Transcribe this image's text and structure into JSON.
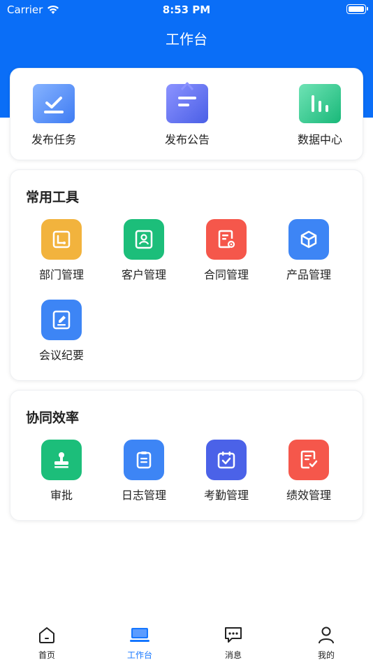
{
  "status": {
    "carrier": "Carrier",
    "time": "8:53 PM"
  },
  "header": {
    "title": "工作台"
  },
  "top_actions": [
    {
      "label": "发布任务",
      "icon": "task-check-icon"
    },
    {
      "label": "发布公告",
      "icon": "notice-board-icon"
    },
    {
      "label": "数据中心",
      "icon": "bar-chart-icon"
    }
  ],
  "tools": {
    "title": "常用工具",
    "items": [
      {
        "label": "部门管理",
        "icon": "department-icon",
        "color": "#f2b33d"
      },
      {
        "label": "客户管理",
        "icon": "contact-card-icon",
        "color": "#1cbe7a"
      },
      {
        "label": "合同管理",
        "icon": "contract-icon",
        "color": "#f5574b"
      },
      {
        "label": "产品管理",
        "icon": "product-box-icon",
        "color": "#3d85f5"
      },
      {
        "label": "会议纪要",
        "icon": "meeting-note-icon",
        "color": "#3d85f5"
      }
    ]
  },
  "collab": {
    "title": "协同效率",
    "items": [
      {
        "label": "审批",
        "icon": "stamp-icon",
        "color": "#1cbe7a"
      },
      {
        "label": "日志管理",
        "icon": "log-icon",
        "color": "#3d85f5"
      },
      {
        "label": "考勤管理",
        "icon": "calendar-check-icon",
        "color": "#4b62e8"
      },
      {
        "label": "绩效管理",
        "icon": "performance-icon",
        "color": "#f5574b"
      }
    ]
  },
  "tabbar": [
    {
      "label": "首页",
      "icon": "home-icon"
    },
    {
      "label": "工作台",
      "icon": "workbench-icon",
      "active": true
    },
    {
      "label": "消息",
      "icon": "message-icon"
    },
    {
      "label": "我的",
      "icon": "user-icon"
    }
  ]
}
